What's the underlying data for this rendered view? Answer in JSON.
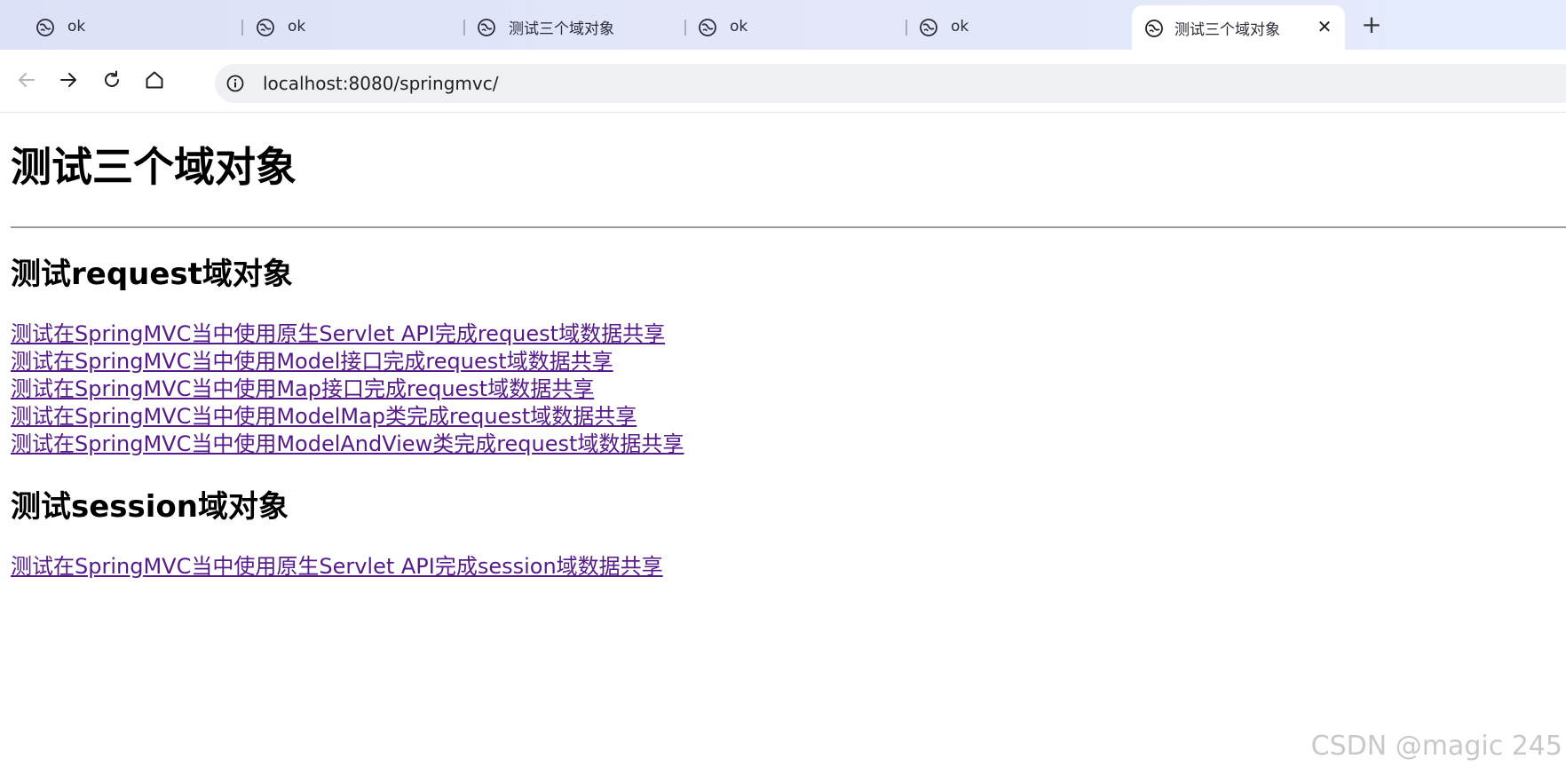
{
  "tabs": [
    {
      "label": "ok",
      "active": false
    },
    {
      "label": "ok",
      "active": false
    },
    {
      "label": "测试三个域对象",
      "active": false
    },
    {
      "label": "ok",
      "active": false
    },
    {
      "label": "ok",
      "active": false
    },
    {
      "label": "测试三个域对象",
      "active": true
    }
  ],
  "tab_close_glyph": "✕",
  "new_tab_glyph": "+",
  "address_bar": {
    "url": "localhost:8080/springmvc/"
  },
  "icons": {
    "back": "arrow-left-icon",
    "forward": "arrow-right-icon",
    "reload": "reload-icon",
    "home": "home-icon",
    "site_info": "info-icon",
    "favicon": "globe-favicon-icon"
  },
  "page": {
    "title": "测试三个域对象",
    "request_section": {
      "heading": "测试request域对象",
      "links": [
        "测试在SpringMVC当中使用原生Servlet API完成request域数据共享",
        "测试在SpringMVC当中使用Model接口完成request域数据共享",
        "测试在SpringMVC当中使用Map接口完成request域数据共享",
        "测试在SpringMVC当中使用ModelMap类完成request域数据共享",
        "测试在SpringMVC当中使用ModelAndView类完成request域数据共享"
      ]
    },
    "session_section": {
      "heading": "测试session域对象",
      "links": [
        "测试在SpringMVC当中使用原生Servlet API完成session域数据共享"
      ]
    }
  },
  "watermark": "CSDN @magic 245",
  "colors": {
    "visited_link": "#551a8b",
    "tabstrip_bg": "#dde1f7",
    "omnibox_bg": "#eef0f4"
  }
}
